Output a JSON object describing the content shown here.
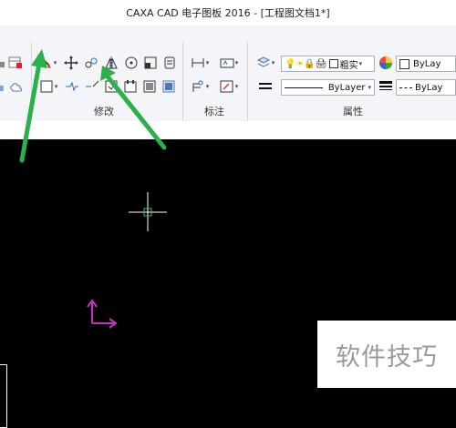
{
  "window": {
    "title": "CAXA CAD 电子图板 2016 - [工程图文档1*]"
  },
  "ribbon": {
    "groups": [
      {
        "label": "修改"
      },
      {
        "label": "标注"
      },
      {
        "label": "属性"
      }
    ],
    "line_style": {
      "value": "ByLayer"
    },
    "layer_color": {
      "value": "ByLay"
    },
    "color_dropdown": {
      "value": "ByLay"
    },
    "thickness_label": "粗实"
  },
  "annotations": {
    "arrow_color": "#2bb04a"
  },
  "watermark": {
    "text": "软件技巧"
  },
  "colors": {
    "canvas": "#000000",
    "cursor": "#ffffff",
    "ucs": "#c632c8",
    "arrow": "#2bb04a"
  }
}
